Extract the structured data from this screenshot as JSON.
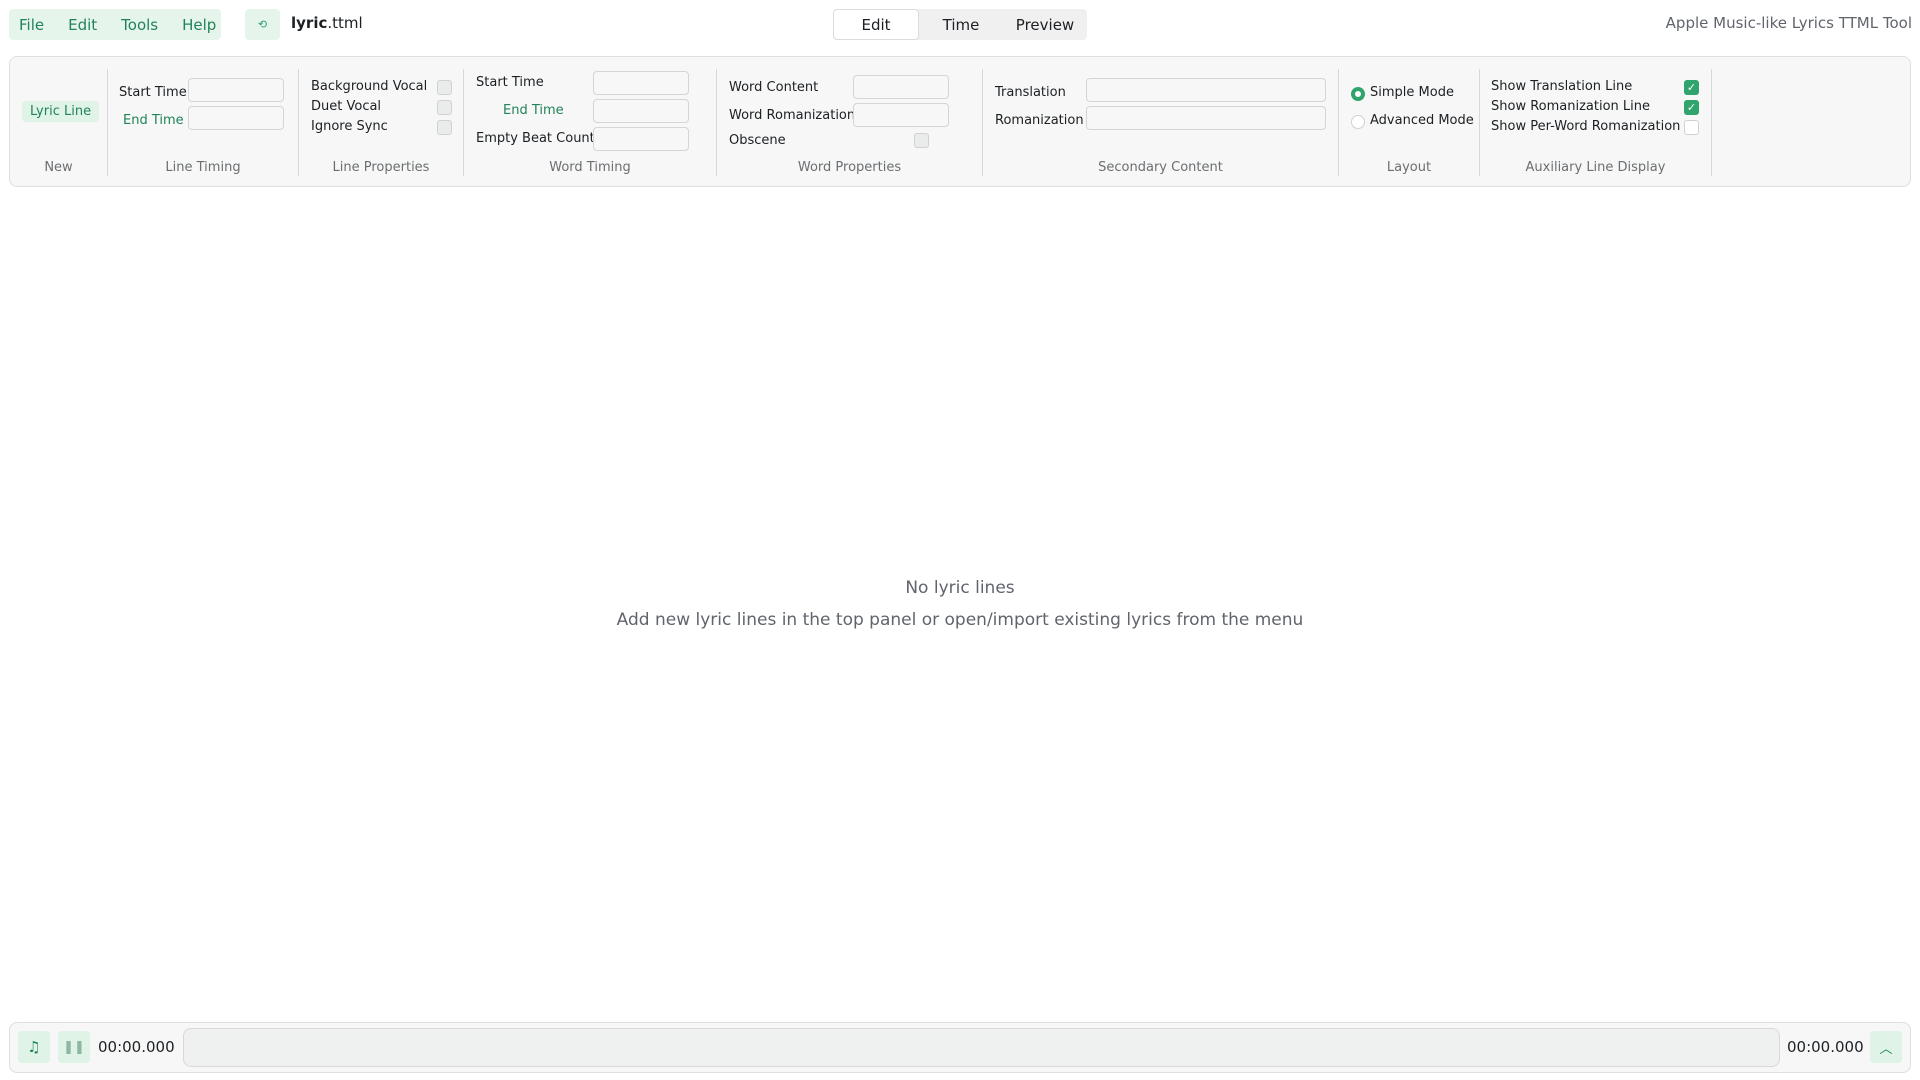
{
  "menu": [
    "File",
    "Edit",
    "Tools",
    "Help"
  ],
  "file": {
    "name": "lyric",
    "ext": ".ttml"
  },
  "tabs": [
    "Edit",
    "Time",
    "Preview"
  ],
  "app_title": "Apple Music-like Lyrics TTML Tool",
  "panel": {
    "new": {
      "button": "Lyric Line",
      "label": "New"
    },
    "line_timing": {
      "start": "Start Time",
      "end": "End Time",
      "label": "Line Timing"
    },
    "line_props": {
      "bg": "Background Vocal",
      "duet": "Duet Vocal",
      "ignore": "Ignore Sync",
      "label": "Line Properties"
    },
    "word_timing": {
      "start": "Start Time",
      "end": "End Time",
      "beat": "Empty Beat Count",
      "label": "Word Timing"
    },
    "word_props": {
      "content": "Word Content",
      "roman": "Word Romanization",
      "obscene": "Obscene",
      "label": "Word Properties"
    },
    "secondary": {
      "translation": "Translation",
      "roman": "Romanization",
      "label": "Secondary Content"
    },
    "layout": {
      "simple": "Simple Mode",
      "advanced": "Advanced Mode",
      "label": "Layout",
      "selected": "Simple Mode"
    },
    "aux": {
      "trans": "Show Translation Line",
      "roman": "Show Romanization Line",
      "perword": "Show Per-Word Romanization",
      "label": "Auxiliary Line Display",
      "trans_checked": true,
      "roman_checked": true,
      "perword_checked": false
    }
  },
  "empty": {
    "title": "No lyric lines",
    "hint": "Add new lyric lines in the top panel or open/import existing lyrics from the menu"
  },
  "player": {
    "current": "00:00.000",
    "total": "00:00.000",
    "progress": 0
  }
}
